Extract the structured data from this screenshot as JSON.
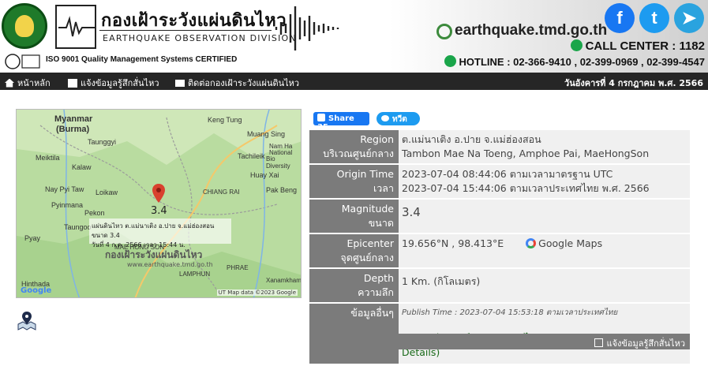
{
  "header": {
    "tmd_thai": "กองเฝ้าระวังแผ่นดินไหว",
    "tmd_eng": "EARTHQUAKE OBSERVATION DIVISION",
    "iso": "ISO 9001 Quality Management Systems CERTIFIED",
    "site": "earthquake.tmd.go.th",
    "call_center": "CALL CENTER : 1182",
    "hotline": "HOTLINE : 02-366-9410 , 02-399-0969 , 02-399-4547",
    "social": [
      "f",
      "t",
      "telegram"
    ]
  },
  "nav": {
    "home": "หน้าหลัก",
    "report": "แจ้งข้อมูลรู้สึกสั่นไหว",
    "contact": "ติดต่อกองเฝ้าระวังแผ่นดินไหว",
    "date": "วันอังคารที่ 4 กรกฎาคม พ.ศ. 2566"
  },
  "map": {
    "labels": [
      "Myanmar",
      "(Burma)",
      "Keng Tung",
      "Tachileik",
      "Muang Sing",
      "Nam Ha",
      "National",
      "Bio Diversity",
      "Huay Xai",
      "Pak Beng",
      "CHIANG RAI",
      "Taunggyi",
      "Kalaw",
      "Loikaw",
      "Nay Pyi Taw",
      "Pyinmana",
      "Taungoo",
      "Pyay",
      "Hinthada",
      "LAMPHUN",
      "PHRAE",
      "Xanamkham",
      "Meiktila",
      "Pekon",
      "MAE HONG SON"
    ],
    "magnitude": "3.4",
    "popup_line1": "แผ่นดินไหว ต.แม่นาเติง อ.ปาย จ.แม่ฮ่องสอน ขนาด 3.4",
    "popup_line2": "วันที่ 4 ก.ค. 2566 เวลา 15:44 น.",
    "watermark": "กองเฝ้าระวังแผ่นดินไหว",
    "watermark_url": "www.earthquake.tmd.go.th",
    "google": "Google",
    "copyright": "UT  Map data ©2023 Google"
  },
  "share": {
    "facebook": "Share 35",
    "tweet": "ทวีต"
  },
  "details": {
    "region_label_en": "Region",
    "region_label_th": "บริเวณศูนย์กลาง",
    "region_th": "ต.แม่นาเติง อ.ปาย จ.แม่ฮ่องสอน",
    "region_en": "Tambon Mae Na Toeng, Amphoe Pai, MaeHongSon",
    "origin_label_en": "Origin Time",
    "origin_label_th": "เวลา",
    "origin_utc": "2023-07-04 08:44:06 ตามเวลามาตรฐาน UTC",
    "origin_local": "2023-07-04 15:44:06 ตามเวลาประเทศไทย พ.ศ. 2566",
    "mag_label_en": "Magnitude",
    "mag_label_th": "ขนาด",
    "magnitude": "3.4",
    "epi_label_en": "Epicenter",
    "epi_label_th": "จุดศูนย์กลาง",
    "epicenter": "19.656°N , 98.413°E",
    "google_maps": "Google Maps",
    "depth_label_en": "Depth",
    "depth_label_th": "ความลึก",
    "depth": "1 Km. (กิโลเมตร)",
    "more_label": "ข้อมูลอื่นๆ",
    "publish": "Publish Time : 2023-07-04 15:53:18 ตามเวลาประเทศไทย",
    "location_link": "รายละเอียดศูนย์กลางแผ่นดินไหว (Earthquake Location Details)",
    "report_link": "แจ้งข้อมูลรู้สึกสั่นไหว"
  },
  "colors": {
    "nav_bg": "#262626",
    "label_bg": "#7b7b7b",
    "value_bg": "#f0f0f0",
    "link": "#1a6a1a",
    "pin": "#d9412e"
  }
}
